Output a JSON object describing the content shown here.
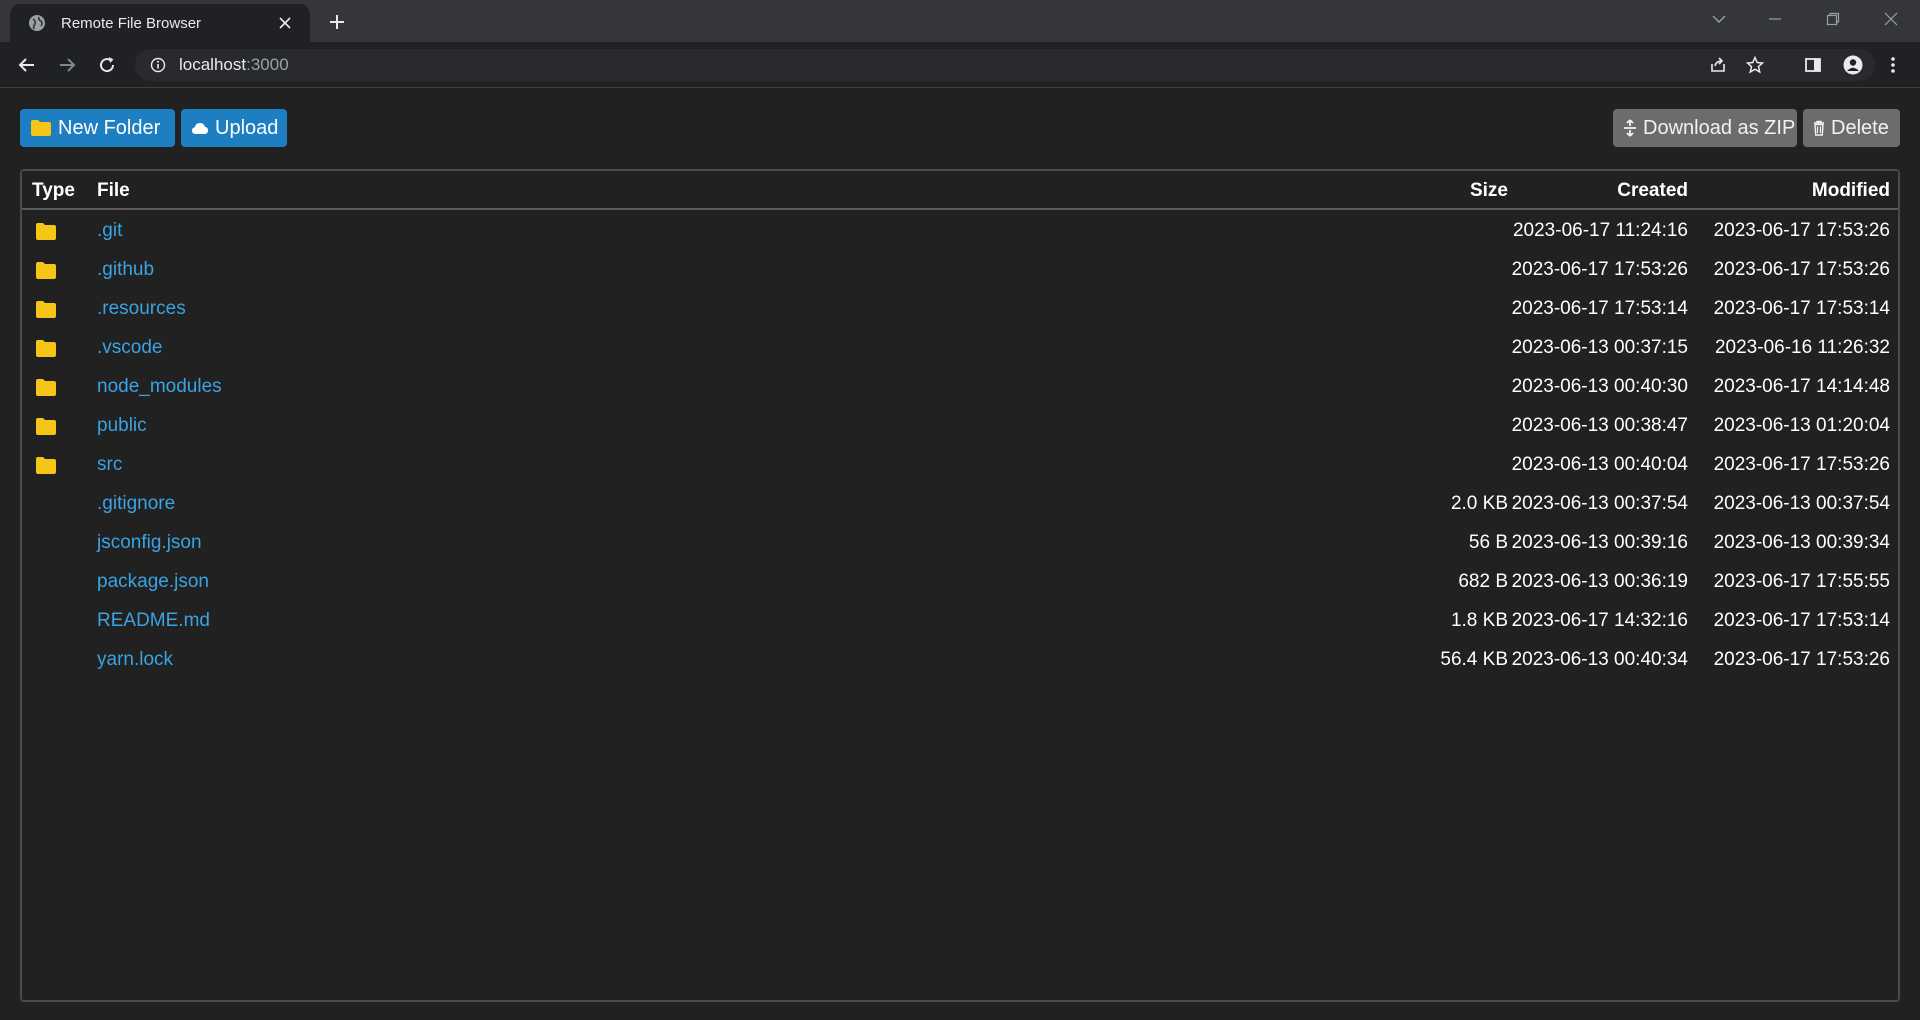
{
  "browser": {
    "tab_title": "Remote File Browser",
    "url_host": "localhost",
    "url_port": ":3000"
  },
  "toolbar": {
    "new_folder_label": "New Folder",
    "upload_label": "Upload",
    "download_zip_label": "Download as ZIP",
    "delete_label": "Delete"
  },
  "table": {
    "headers": {
      "type": "Type",
      "file": "File",
      "size": "Size",
      "created": "Created",
      "modified": "Modified"
    },
    "rows": [
      {
        "kind": "folder",
        "name": ".git",
        "size": "",
        "created": "2023-06-17 11:24:16",
        "modified": "2023-06-17 17:53:26"
      },
      {
        "kind": "folder",
        "name": ".github",
        "size": "",
        "created": "2023-06-17 17:53:26",
        "modified": "2023-06-17 17:53:26"
      },
      {
        "kind": "folder",
        "name": ".resources",
        "size": "",
        "created": "2023-06-17 17:53:14",
        "modified": "2023-06-17 17:53:14"
      },
      {
        "kind": "folder",
        "name": ".vscode",
        "size": "",
        "created": "2023-06-13 00:37:15",
        "modified": "2023-06-16 11:26:32"
      },
      {
        "kind": "folder",
        "name": "node_modules",
        "size": "",
        "created": "2023-06-13 00:40:30",
        "modified": "2023-06-17 14:14:48"
      },
      {
        "kind": "folder",
        "name": "public",
        "size": "",
        "created": "2023-06-13 00:38:47",
        "modified": "2023-06-13 01:20:04"
      },
      {
        "kind": "folder",
        "name": "src",
        "size": "",
        "created": "2023-06-13 00:40:04",
        "modified": "2023-06-17 17:53:26"
      },
      {
        "kind": "file",
        "name": ".gitignore",
        "size": "2.0 KB",
        "created": "2023-06-13 00:37:54",
        "modified": "2023-06-13 00:37:54"
      },
      {
        "kind": "file",
        "name": "jsconfig.json",
        "size": "56 B",
        "created": "2023-06-13 00:39:16",
        "modified": "2023-06-13 00:39:34"
      },
      {
        "kind": "file",
        "name": "package.json",
        "size": "682 B",
        "created": "2023-06-13 00:36:19",
        "modified": "2023-06-17 17:55:55"
      },
      {
        "kind": "file",
        "name": "README.md",
        "size": "1.8 KB",
        "created": "2023-06-17 14:32:16",
        "modified": "2023-06-17 17:53:14"
      },
      {
        "kind": "file",
        "name": "yarn.lock",
        "size": "56.4 KB",
        "created": "2023-06-13 00:40:34",
        "modified": "2023-06-17 17:53:26"
      }
    ]
  },
  "icons": {
    "folder": "folder-icon",
    "upload": "cloud-icon",
    "download": "zip-icon",
    "delete": "trash-icon"
  },
  "colors": {
    "accent": "#1d7ec2",
    "link": "#3aa3e3",
    "folder": "#f5c518",
    "gray_button": "#6c6c6c"
  }
}
